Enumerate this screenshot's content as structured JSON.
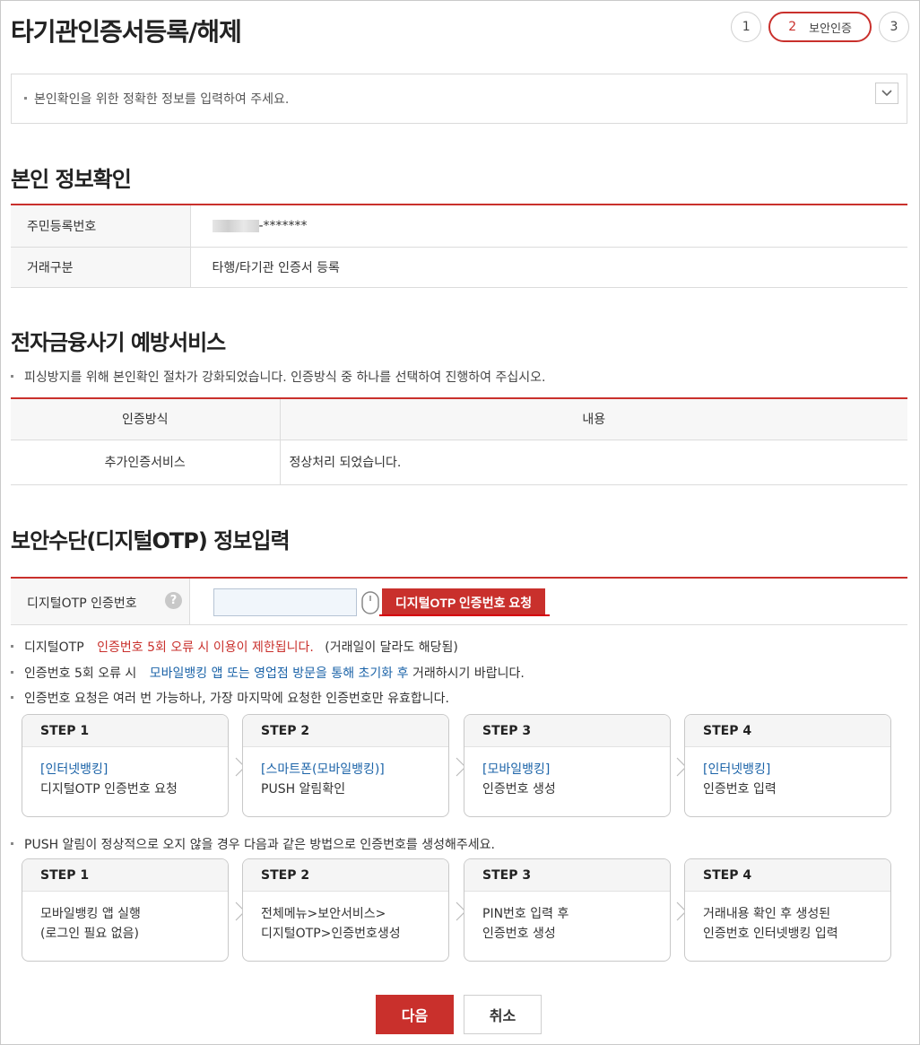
{
  "page": {
    "title": "타기관인증서등록/해제"
  },
  "stepper": {
    "step1": "1",
    "step2_num": "2",
    "step2_label": "보안인증",
    "step3": "3"
  },
  "notice": {
    "text": "본인확인을 위한 정확한 정보를 입력하여 주세요."
  },
  "identity": {
    "heading": "본인 정보확인",
    "rows": [
      {
        "label": "주민등록번호",
        "value": "-*******"
      },
      {
        "label": "거래구분",
        "value": "타행/타기관 인증서 등록"
      }
    ]
  },
  "fraud": {
    "heading": "전자금융사기 예방서비스",
    "desc": "피싱방지를 위해 본인확인 절차가 강화되었습니다. 인증방식 중 하나를 선택하여 진행하여 주십시오.",
    "columns": [
      "인증방식",
      "내용"
    ],
    "rows": [
      {
        "method": "추가인증서비스",
        "content": "정상처리 되었습니다."
      }
    ]
  },
  "otp": {
    "heading": "보안수단(디지털OTP) 정보입력",
    "label": "디지털OTP 인증번호",
    "help": "?",
    "input_value": "",
    "request_button": "디지털OTP 인증번호 요청",
    "notes": {
      "n1_a": "디지털OTP",
      "n1_b": "인증번호 5회 오류 시 이용이 제한됩니다.",
      "n1_c": "(거래일이 달라도 해당됨)",
      "n2_a": "인증번호 5회 오류 시",
      "n2_b": "모바일뱅킹 앱 또는 영업점 방문을 통해 초기화 후",
      "n2_c": "거래하시기 바랍니다.",
      "n3": "인증번호 요청은 여러 번 가능하나, 가장 마지막에 요청한 인증번호만 유효합니다.",
      "n4": "PUSH 알림이 정상적으로 오지 않을 경우 다음과 같은 방법으로 인증번호를 생성해주세요."
    },
    "steps_a": [
      {
        "title": "STEP 1",
        "link": "[인터넷뱅킹]",
        "text": "디지털OTP 인증번호 요청"
      },
      {
        "title": "STEP 2",
        "link": "[스마트폰(모바일뱅킹)]",
        "text": "PUSH 알림확인"
      },
      {
        "title": "STEP 3",
        "link": "[모바일뱅킹]",
        "text": "인증번호 생성"
      },
      {
        "title": "STEP 4",
        "link": "[인터넷뱅킹]",
        "text": "인증번호 입력"
      }
    ],
    "steps_b": [
      {
        "title": "STEP 1",
        "line1": "모바일뱅킹 앱 실행",
        "line2": "(로그인 필요 없음)"
      },
      {
        "title": "STEP 2",
        "line1": "전체메뉴>보안서비스>",
        "line2": "디지털OTP>인증번호생성"
      },
      {
        "title": "STEP 3",
        "line1": "PIN번호 입력 후",
        "line2": "인증번호 생성"
      },
      {
        "title": "STEP 4",
        "line1": "거래내용 확인 후 생성된",
        "line2": "인증번호 인터넷뱅킹 입력"
      }
    ]
  },
  "buttons": {
    "next": "다음",
    "cancel": "취소"
  },
  "colors": {
    "accent": "#c9302c",
    "link": "#1b63a8"
  }
}
